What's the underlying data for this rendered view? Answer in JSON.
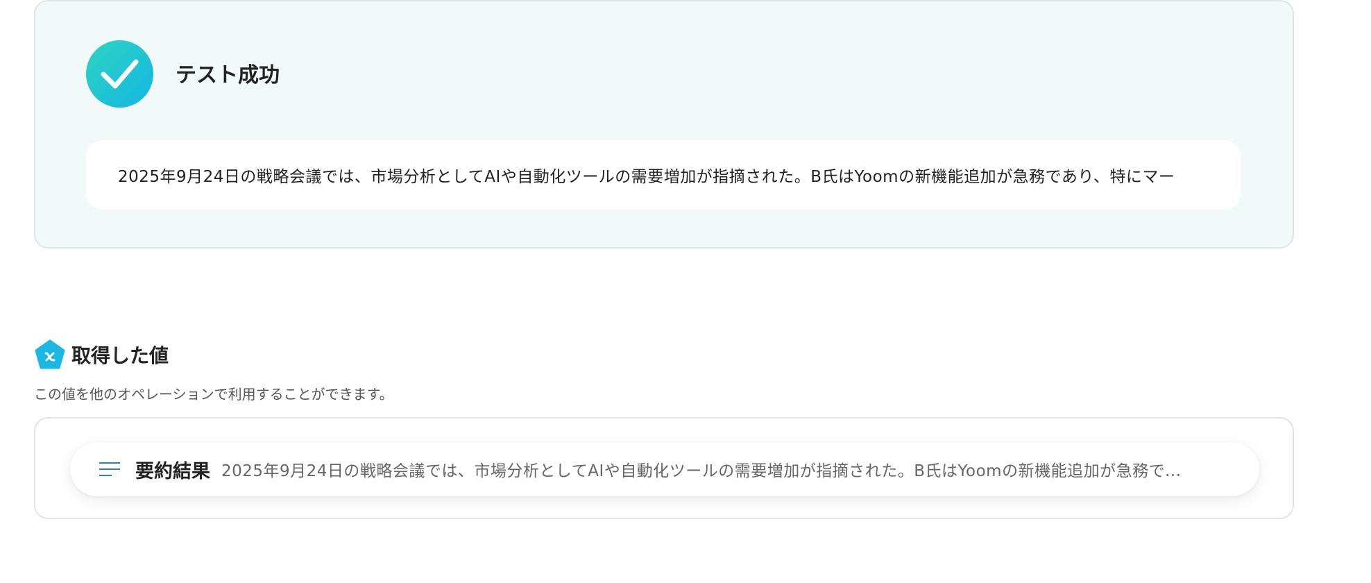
{
  "test_result": {
    "status_icon": "check-icon",
    "title": "テスト成功",
    "output_text": "2025年9月24日の戦略会議では、市場分析としてAIや自動化ツールの需要増加が指摘された。B氏はYoomの新機能追加が急務であり、特にマー"
  },
  "obtained_values": {
    "icon": "variable-pentagon-icon",
    "title": "取得した値",
    "description": "この値を他のオペレーションで利用することができます。",
    "items": [
      {
        "icon": "text-lines-icon",
        "label": "要約結果",
        "value": "2025年9月24日の戦略会議では、市場分析としてAIや自動化ツールの需要増加が指摘された。B氏はYoomの新機能追加が急務で..."
      }
    ]
  },
  "colors": {
    "panel_background": "#f1faf8",
    "panel_border": "#e1e4e5",
    "accent_gradient_start": "#2dd4bf",
    "accent_gradient_end": "#13b6e4",
    "variable_icon": "#1ab7e3",
    "lines_icon": "#2a7fb6"
  }
}
